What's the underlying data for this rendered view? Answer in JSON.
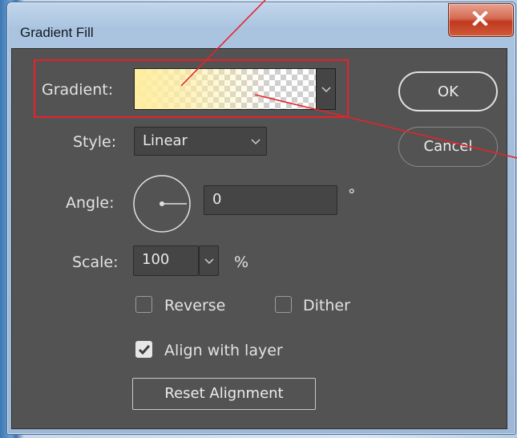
{
  "window": {
    "title": "Gradient Fill"
  },
  "gradient": {
    "label": "Gradient:"
  },
  "style": {
    "label": "Style:",
    "value": "Linear"
  },
  "angle": {
    "label": "Angle:",
    "value": "0",
    "unit": "°"
  },
  "scale": {
    "label": "Scale:",
    "value": "100",
    "unit": "%"
  },
  "options": {
    "reverse": {
      "label": "Reverse",
      "checked": false
    },
    "dither": {
      "label": "Dither",
      "checked": false
    },
    "align": {
      "label": "Align with layer",
      "checked": true
    }
  },
  "buttons": {
    "ok": "OK",
    "cancel": "Cancel",
    "reset": "Reset Alignment"
  },
  "colors": {
    "highlight": "#e8212a",
    "gradient_start": "#ffeea0",
    "dialog_bg": "#535353"
  }
}
